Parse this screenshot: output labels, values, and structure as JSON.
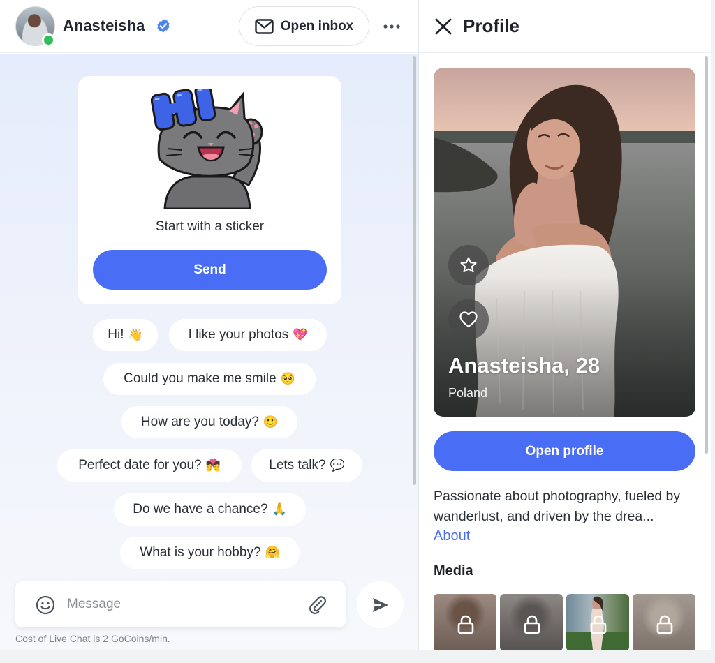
{
  "chat_header": {
    "name": "Anasteisha",
    "open_inbox_label": "Open inbox"
  },
  "sticker_card": {
    "sticker_text": "HI",
    "caption": "Start with a sticker",
    "send_label": "Send"
  },
  "quick_replies": [
    {
      "text": "Hi!",
      "emoji": "👋"
    },
    {
      "text": "I like your photos",
      "emoji": "💖"
    },
    {
      "text": "Could you make me smile",
      "emoji": "🥺"
    },
    {
      "text": "How are you today?",
      "emoji": "🙂"
    },
    {
      "text": "Perfect date for you?",
      "emoji": "💏"
    },
    {
      "text": "Lets talk?",
      "emoji": "💬"
    },
    {
      "text": "Do we have a chance?",
      "emoji": "🙏"
    },
    {
      "text": "What is your hobby?",
      "emoji": "🤗"
    }
  ],
  "composer": {
    "placeholder": "Message",
    "cost_note": "Cost of Live Chat is 2 GoCoins/min."
  },
  "profile": {
    "title": "Profile",
    "name_age": "Anasteisha, 28",
    "country": "Poland",
    "open_profile_label": "Open profile",
    "bio": "Passionate about photography, fueled by wanderlust, and driven by the drea...",
    "about_label": "About",
    "media_title": "Media",
    "media": [
      {
        "locked": true,
        "tone": "#8a7466"
      },
      {
        "locked": true,
        "tone": "#6f6b68"
      },
      {
        "locked": true,
        "tone": "#5d7a55"
      },
      {
        "locked": true,
        "tone": "#9a8f86"
      }
    ]
  },
  "colors": {
    "accent": "#4a6df5",
    "online": "#2fbf5a",
    "verified": "#4a86f0"
  },
  "icons": [
    "verified-icon",
    "mail-icon",
    "more-icon",
    "smile-icon",
    "paperclip-icon",
    "send-icon",
    "close-icon",
    "star-icon",
    "heart-icon",
    "lock-icon"
  ]
}
